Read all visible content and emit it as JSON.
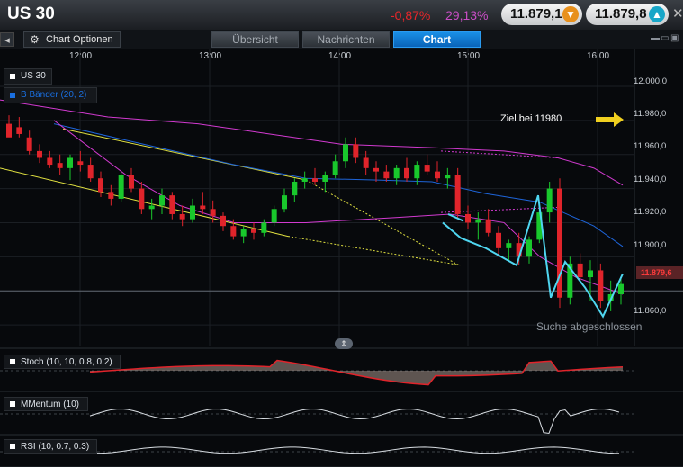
{
  "header": {
    "symbol": "US 30",
    "change_pct": "-0,87%",
    "volatility_pct": "29,13%",
    "bid": "11.879,1",
    "ask": "11.879,8",
    "bid_arrow_color": "#e8901c",
    "ask_arrow_color": "#17a6c8"
  },
  "toolbar": {
    "chart_options_label": "Chart Optionen",
    "tabs": [
      {
        "label": "Übersicht",
        "active": false
      },
      {
        "label": "Nachrichten",
        "active": false
      },
      {
        "label": "Chart",
        "active": true
      }
    ]
  },
  "legend": {
    "instrument": "US 30",
    "bands": "B Bänder (20, 2)",
    "bands_color": "#1a6fe0"
  },
  "annotations": {
    "target": "Ziel bei 11980",
    "search_status": "Suche abgeschlossen",
    "last_price": "11.879,6"
  },
  "indicators": [
    {
      "label": "Stoch (10, 10, 0.8, 0.2)"
    },
    {
      "label": "MMentum (10)"
    },
    {
      "label": "RSI (10, 0.7, 0.3)"
    }
  ],
  "colors": {
    "up": "#19c82c",
    "down": "#e0242b",
    "bands_upper": "#d23ad0",
    "bands_mid": "#1e64d8",
    "trendline": "#e0e040",
    "pattern": "#4fd6f0",
    "target_arrow": "#f0d020"
  },
  "chart_data": {
    "type": "candlestick",
    "x_ticks": [
      "12:00",
      "13:00",
      "14:00",
      "15:00",
      "16:00"
    ],
    "y_ticks": [
      "12.000,0",
      "11.980,0",
      "11.960,0",
      "11.940,0",
      "11.920,0",
      "11.900,0",
      "11.880,0",
      "11.860,0"
    ],
    "ylim": [
      11850,
      12010
    ],
    "candles": [
      [
        11978,
        11983,
        11972,
        11970
      ],
      [
        11976,
        11982,
        11970,
        11972
      ],
      [
        11970,
        11974,
        11960,
        11962
      ],
      [
        11962,
        11966,
        11955,
        11958
      ],
      [
        11958,
        11962,
        11952,
        11954
      ],
      [
        11955,
        11960,
        11948,
        11952
      ],
      [
        11952,
        11960,
        11945,
        11958
      ],
      [
        11956,
        11962,
        11950,
        11954
      ],
      [
        11954,
        11958,
        11944,
        11946
      ],
      [
        11946,
        11950,
        11935,
        11938
      ],
      [
        11938,
        11942,
        11930,
        11934
      ],
      [
        11934,
        11950,
        11932,
        11948
      ],
      [
        11948,
        11952,
        11938,
        11940
      ],
      [
        11940,
        11944,
        11925,
        11928
      ],
      [
        11928,
        11934,
        11922,
        11930
      ],
      [
        11930,
        11940,
        11925,
        11936
      ],
      [
        11936,
        11938,
        11922,
        11925
      ],
      [
        11925,
        11930,
        11918,
        11922
      ],
      [
        11922,
        11934,
        11920,
        11930
      ],
      [
        11930,
        11938,
        11925,
        11928
      ],
      [
        11928,
        11933,
        11920,
        11924
      ],
      [
        11924,
        11926,
        11915,
        11918
      ],
      [
        11918,
        11922,
        11910,
        11912
      ],
      [
        11912,
        11918,
        11908,
        11916
      ],
      [
        11916,
        11920,
        11910,
        11914
      ],
      [
        11914,
        11922,
        11912,
        11920
      ],
      [
        11920,
        11930,
        11918,
        11928
      ],
      [
        11928,
        11940,
        11926,
        11936
      ],
      [
        11936,
        11946,
        11932,
        11944
      ],
      [
        11944,
        11950,
        11940,
        11946
      ],
      [
        11946,
        11952,
        11942,
        11944
      ],
      [
        11944,
        11950,
        11938,
        11948
      ],
      [
        11948,
        11960,
        11946,
        11956
      ],
      [
        11956,
        11970,
        11952,
        11966
      ],
      [
        11966,
        11970,
        11955,
        11958
      ],
      [
        11958,
        11962,
        11948,
        11952
      ],
      [
        11952,
        11956,
        11944,
        11950
      ],
      [
        11950,
        11954,
        11944,
        11946
      ],
      [
        11946,
        11954,
        11942,
        11952
      ],
      [
        11952,
        11958,
        11944,
        11946
      ],
      [
        11946,
        11956,
        11942,
        11954
      ],
      [
        11954,
        11960,
        11948,
        11950
      ],
      [
        11950,
        11956,
        11944,
        11946
      ],
      [
        11946,
        11952,
        11940,
        11948
      ],
      [
        11948,
        11952,
        11922,
        11925
      ],
      [
        11925,
        11930,
        11916,
        11920
      ],
      [
        11920,
        11926,
        11910,
        11922
      ],
      [
        11922,
        11928,
        11912,
        11914
      ],
      [
        11914,
        11918,
        11900,
        11905
      ],
      [
        11905,
        11910,
        11898,
        11908
      ],
      [
        11908,
        11914,
        11895,
        11900
      ],
      [
        11900,
        11912,
        11896,
        11910
      ],
      [
        11910,
        11928,
        11908,
        11926
      ],
      [
        11926,
        11944,
        11920,
        11940
      ],
      [
        11940,
        11946,
        11870,
        11876
      ],
      [
        11876,
        11900,
        11872,
        11896
      ],
      [
        11896,
        11902,
        11884,
        11888
      ],
      [
        11888,
        11898,
        11874,
        11892
      ],
      [
        11892,
        11896,
        11870,
        11874
      ],
      [
        11874,
        11886,
        11868,
        11878
      ],
      [
        11878,
        11888,
        11872,
        11884
      ]
    ]
  }
}
